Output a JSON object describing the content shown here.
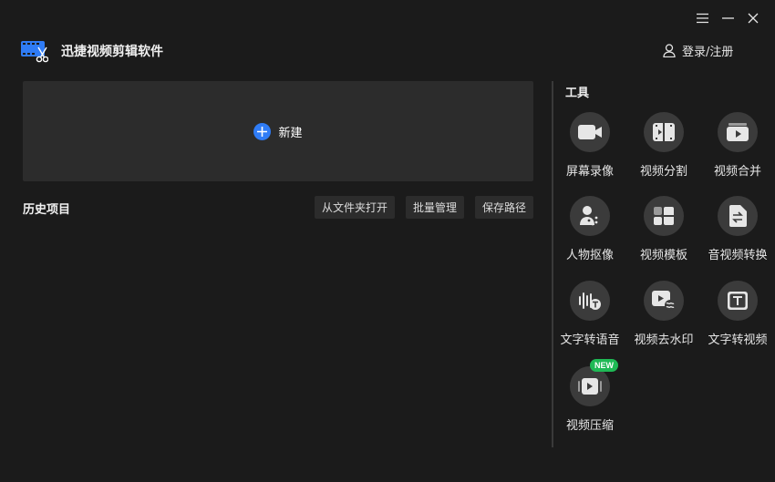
{
  "window": {
    "menu_icon": "menu-icon",
    "minimize_icon": "minimize-icon",
    "close_icon": "close-icon"
  },
  "app": {
    "name": "迅捷视频剪辑软件",
    "logo_icon": "video-scissors-logo-icon"
  },
  "account": {
    "login_label": "登录/注册",
    "icon": "user-icon"
  },
  "new_project": {
    "label": "新建",
    "icon": "plus-icon",
    "accent": "#2f7cf6"
  },
  "history": {
    "title": "历史项目",
    "actions": [
      {
        "label": "从文件夹打开"
      },
      {
        "label": "批量管理"
      },
      {
        "label": "保存路径"
      }
    ]
  },
  "tools": {
    "title": "工具",
    "items": [
      {
        "label": "屏幕录像",
        "icon": "camera-icon"
      },
      {
        "label": "视频分割",
        "icon": "film-split-icon"
      },
      {
        "label": "视频合并",
        "icon": "video-merge-icon"
      },
      {
        "label": "人物抠像",
        "icon": "person-cutout-icon"
      },
      {
        "label": "视频模板",
        "icon": "template-icon"
      },
      {
        "label": "音视频转换",
        "icon": "convert-icon"
      },
      {
        "label": "文字转语音",
        "icon": "text-to-speech-icon"
      },
      {
        "label": "视频去水印",
        "icon": "watermark-remove-icon"
      },
      {
        "label": "文字转视频",
        "icon": "text-to-video-icon"
      },
      {
        "label": "视频压缩",
        "icon": "video-compress-icon",
        "badge": "NEW"
      }
    ]
  }
}
